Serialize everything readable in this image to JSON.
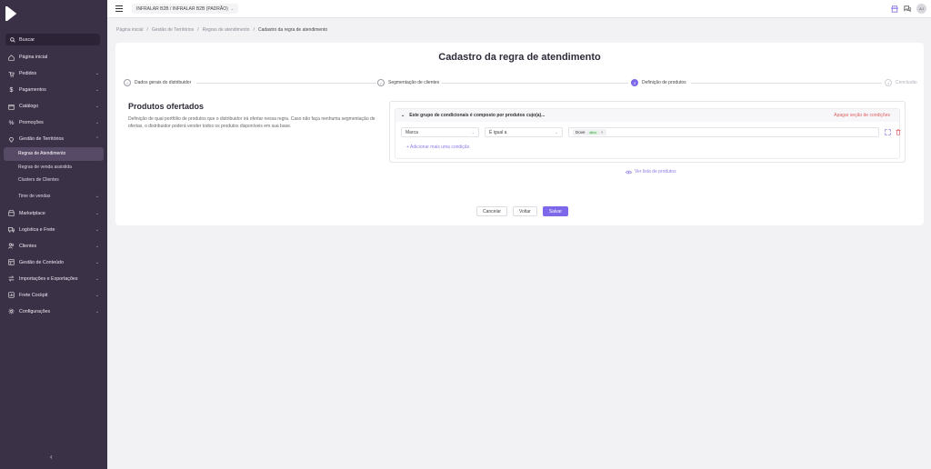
{
  "sidebar": {
    "search_label": "Buscar",
    "items": [
      {
        "label": "Página inicial",
        "chevron": false
      },
      {
        "label": "Pedidos",
        "chevron": true
      },
      {
        "label": "Pagamentos",
        "chevron": true
      },
      {
        "label": "Catálogo",
        "chevron": true
      },
      {
        "label": "Promoções",
        "chevron": true
      },
      {
        "label": "Gestão de Territórios",
        "chevron": true
      }
    ],
    "sub_items": [
      {
        "label": "Regras de Atendimento",
        "active": true
      },
      {
        "label": "Regras de venda assistida",
        "active": false
      },
      {
        "label": "Clusters de Clientes",
        "active": false
      },
      {
        "label": "Time de vendas",
        "active": false
      }
    ],
    "items_after": [
      {
        "label": "Marketplace",
        "chevron": true
      },
      {
        "label": "Logística e Frete",
        "chevron": true
      },
      {
        "label": "Clientes",
        "chevron": true
      },
      {
        "label": "Gestão de Conteúdo",
        "chevron": true
      },
      {
        "label": "Importações e Exportações",
        "chevron": true
      },
      {
        "label": "Frete Cockpit",
        "chevron": true
      },
      {
        "label": "Configurações",
        "chevron": true
      }
    ]
  },
  "topbar": {
    "store_label": "INFRALAR B2B / INFRALAR B2B (PADRÃO)",
    "avatar_initials": "AJ"
  },
  "breadcrumb": {
    "items": [
      "Página inicial",
      "Gestão de Territórios",
      "Regras de atendimento"
    ],
    "current": "Cadastro da regra de atendimento"
  },
  "page": {
    "title": "Cadastro da regra de atendimento",
    "steps": [
      {
        "label": "Dados gerais do distribuidor",
        "state": "done",
        "number": ""
      },
      {
        "label": "Segmentação de clientes",
        "state": "done",
        "number": ""
      },
      {
        "label": "Definição de produtos",
        "state": "active",
        "number": "3"
      },
      {
        "label": "Conclusão",
        "state": "pending",
        "number": "4"
      }
    ],
    "section_title": "Produtos ofertados",
    "section_desc": "Definição de qual portfólio de produtos que o distribuidor irá ofertar nessa regra. Caso não faça nenhuma segmentação de ofertas, o distribuidor poderá vender todos os produtos disponíveis em sua base.",
    "group_heading": "Este grupo de condicionais é composto por produtos cujo(a)...",
    "delete_group_label": "Apagar seção de condições",
    "condition": {
      "field": "Marca",
      "operator": "É igual a",
      "tag_label": "Dove",
      "tag_badge": "ativo"
    },
    "add_condition_label": "Adicionar mais uma condição",
    "view_products_label": "Ver lista de produtos",
    "buttons": {
      "cancel": "Cancelar",
      "back": "Voltar",
      "save": "Salvar"
    }
  },
  "colors": {
    "sidebar_bg": "#3b3147",
    "accent": "#7c68e8",
    "danger": "#e06060"
  }
}
